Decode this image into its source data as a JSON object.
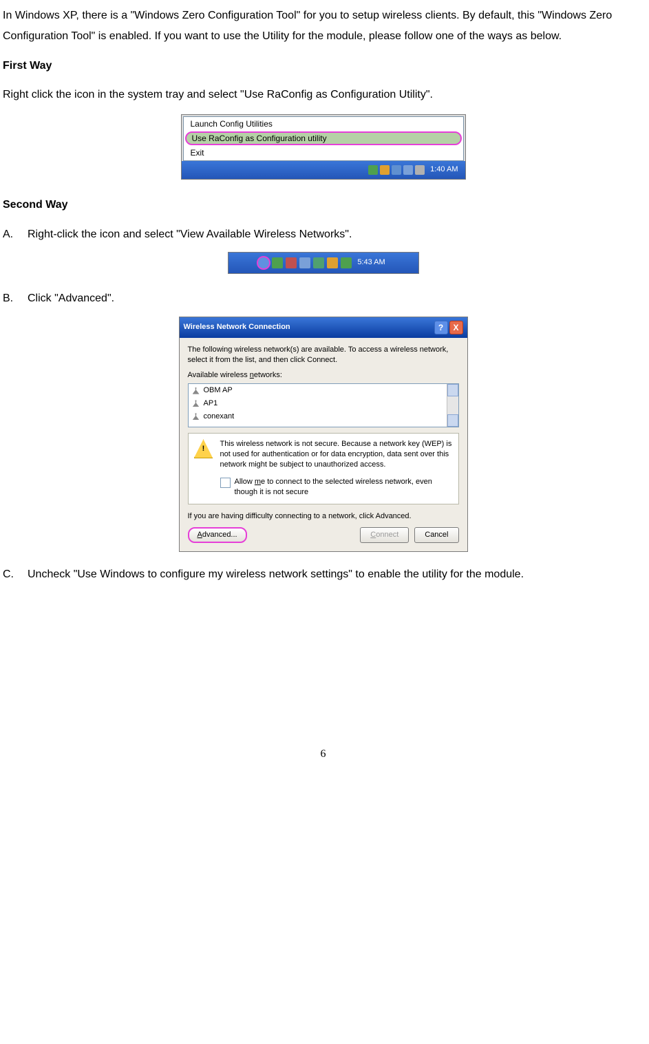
{
  "intro": "In Windows XP, there is a \"Windows Zero Configuration Tool\" for you to setup wireless clients. By default, this \"Windows Zero Configuration Tool\" is enabled. If you want to use the Utility for the module, please follow one of the ways as below.",
  "first_way": {
    "heading": "First Way",
    "text": "Right click the icon in the system tray and select \"Use RaConfig as Configuration Utility\".",
    "menu": {
      "item1": "Launch Config Utilities",
      "item2": "Use RaConfig as Configuration utility",
      "item3": "Exit"
    },
    "clock": "1:40 AM"
  },
  "second_way": {
    "heading": "Second Way",
    "a": {
      "bullet": "A.",
      "text": "Right-click the icon and select \"View Available Wireless Networks\"."
    },
    "b": {
      "bullet": "B.",
      "text": "Click \"Advanced\"."
    },
    "c": {
      "bullet": "C.",
      "text": "Uncheck \"Use Windows to configure my wireless network settings\" to enable the utility for the module."
    },
    "fig2_clock": "5:43 AM"
  },
  "dialog": {
    "title": "Wireless Network Connection",
    "help": "?",
    "close": "X",
    "line1": "The following wireless network(s) are available. To access a wireless network, select it from the list, and then click Connect.",
    "list_label_pre": "Available wireless ",
    "list_label_u": "n",
    "list_label_post": "etworks:",
    "networks": {
      "n0": "OBM AP",
      "n1": "AP1",
      "n2": "conexant"
    },
    "warning": "This wireless network is not secure. Because a network key (WEP) is not used for authentication or for data encryption, data sent over this network might be subject to unauthorized access.",
    "allow_pre": "Allow ",
    "allow_u": "m",
    "allow_post": "e to connect to the selected wireless network, even though it is not secure",
    "trouble": "If you are having difficulty connecting to a network, click Advanced.",
    "btn_adv_u": "A",
    "btn_adv_post": "dvanced...",
    "btn_connect_u": "C",
    "btn_connect_post": "onnect",
    "btn_cancel": "Cancel"
  },
  "page_number": "6"
}
